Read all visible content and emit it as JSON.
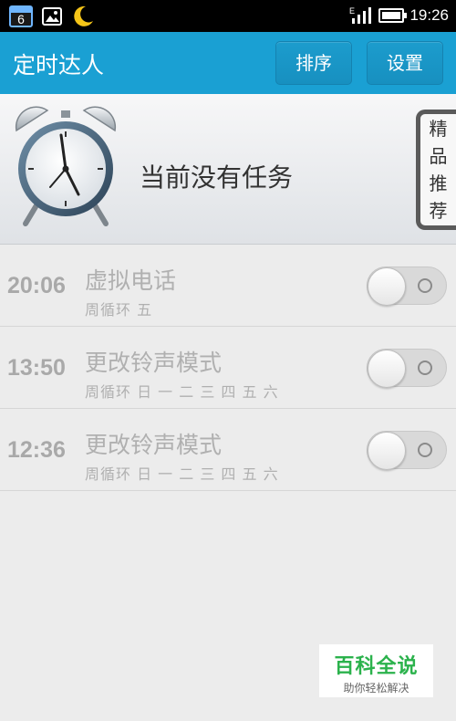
{
  "status_bar": {
    "calendar_day": "6",
    "time": "19:26",
    "icons": [
      "calendar-icon",
      "gallery-icon",
      "moon-icon",
      "signal-icon",
      "battery-icon"
    ]
  },
  "header": {
    "title": "定时达人",
    "sort_label": "排序",
    "settings_label": "设置",
    "accent_color": "#1aa0d3"
  },
  "banner": {
    "message": "当前没有任务",
    "featured_tab": [
      "精",
      "品",
      "推",
      "荐"
    ]
  },
  "tasks": [
    {
      "time": "20:06",
      "name": "虚拟电话",
      "repeat": "周循环 五",
      "enabled": false
    },
    {
      "time": "13:50",
      "name": "更改铃声模式",
      "repeat": "周循环 日 一 二 三 四 五 六",
      "enabled": false
    },
    {
      "time": "12:36",
      "name": "更改铃声模式",
      "repeat": "周循环 日 一 二 三 四 五 六",
      "enabled": false
    }
  ],
  "watermark": {
    "title": "百科全说",
    "subtitle": "助你轻松解决"
  }
}
